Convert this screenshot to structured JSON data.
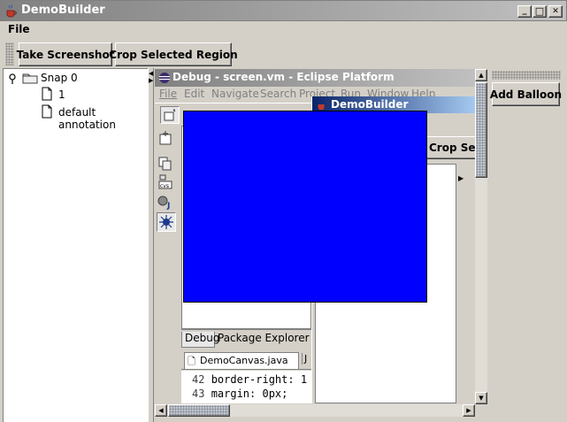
{
  "window": {
    "title": "DemoBuilder",
    "minimize_glyph": "_",
    "maximize_glyph": "□",
    "close_glyph": "✕"
  },
  "menu": {
    "file": "File"
  },
  "toolbar": {
    "take_screenshot": "Take Screenshot",
    "crop_selected_region": "Crop Selected Region",
    "add_balloon": "Add Balloon"
  },
  "tree": {
    "root_label": "Snap 0",
    "children": [
      {
        "label": "1"
      },
      {
        "label": "default annotation"
      }
    ]
  },
  "eclipse": {
    "title": "Debug - screen.vm - Eclipse Platform",
    "menus": [
      "File",
      "Edit",
      "Navigate",
      "Search",
      "Project",
      "Run",
      "Window",
      "Help"
    ],
    "tabs": {
      "debug": "Debug",
      "package_explorer": "Package Explorer"
    },
    "editor_tab": "DemoCanvas.java",
    "editor_tab_overflow": "J",
    "code_lines": [
      {
        "num": "42",
        "text": "border-right: 1"
      },
      {
        "num": "43",
        "text": "margin: 0px;"
      }
    ],
    "perspective_icons": [
      "new-perspective-icon",
      "resource-icon",
      "cvs-icon",
      "java-icon",
      "debug-icon"
    ]
  },
  "inner_window": {
    "title": "DemoBuilder",
    "crop_button_partial": "Crop Selec"
  },
  "selection": {
    "color": "#0000ff"
  },
  "colors": {
    "title_bar_gradient_start": "#808080",
    "title_bar_gradient_end": "#c0c0c0",
    "eclipse_title_start": "#808080",
    "inner_title_start": "#0a246a",
    "inner_title_end": "#a6caf0",
    "window_bg": "#d4d0c8"
  }
}
